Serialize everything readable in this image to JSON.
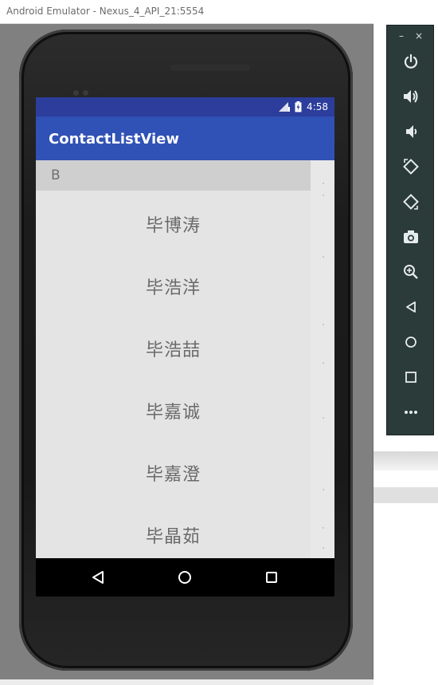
{
  "window": {
    "title": "Android Emulator - Nexus_4_API_21:5554"
  },
  "statusbar": {
    "time": "4:58"
  },
  "app": {
    "title": "ContactListView"
  },
  "list": {
    "section": "B",
    "contacts": [
      "毕博涛",
      "毕浩洋",
      "毕浩喆",
      "毕嘉诚",
      "毕嘉澄",
      "毕晶茹"
    ]
  },
  "toolbar": {
    "minimize": "–",
    "close": "×",
    "buttons": [
      "power-icon",
      "volume-up-icon",
      "volume-down-icon",
      "rotate-left-icon",
      "rotate-right-icon",
      "camera-icon",
      "zoom-icon",
      "back-icon",
      "home-icon",
      "overview-icon",
      "more-icon"
    ]
  },
  "colors": {
    "statusbar": "#2c3d9c",
    "appbar": "#3051b5",
    "toolbar": "#2b3b3a"
  }
}
